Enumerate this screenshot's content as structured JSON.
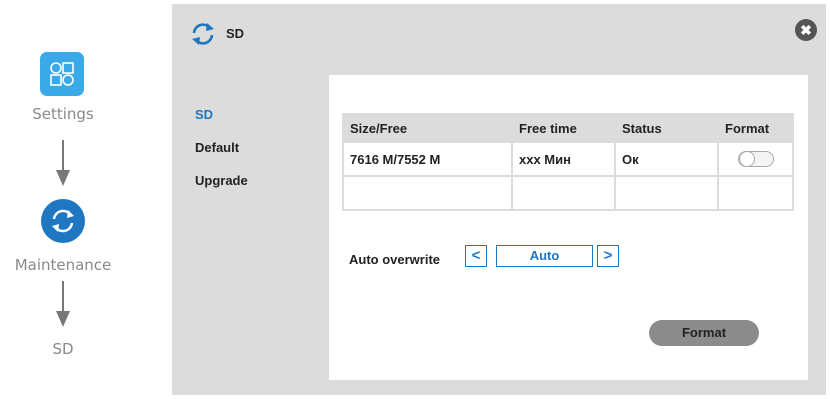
{
  "flow": {
    "settings_label": "Settings",
    "maintenance_label": "Maintenance",
    "sd_label": "SD"
  },
  "dialog": {
    "title": "SD",
    "close_glyph": "✖"
  },
  "nav": {
    "items": [
      {
        "label": "SD",
        "active": true
      },
      {
        "label": "Default",
        "active": false
      },
      {
        "label": "Upgrade",
        "active": false
      }
    ]
  },
  "table": {
    "headers": [
      "Size/Free",
      "Free time",
      "Status",
      "Format"
    ],
    "rows": [
      {
        "size_free": "7616 M/7552 M",
        "free_time": "xxx Мин",
        "status": "Ок",
        "format_toggle": "off"
      },
      {
        "size_free": "",
        "free_time": "",
        "status": "",
        "format_toggle": ""
      }
    ]
  },
  "auto_overwrite": {
    "label": "Auto overwrite",
    "prev_glyph": "<",
    "value": "Auto",
    "next_glyph": ">"
  },
  "format_button_label": "Format",
  "colors": {
    "accent": "#1f77c2",
    "tile": "#3aa9e8",
    "panel_bg": "#dcdcdc",
    "button_gray": "#8c8c8c"
  },
  "icons": [
    "settings-grid-icon",
    "refresh-icon",
    "arrow-down-icon",
    "close-icon",
    "chevron-left-icon",
    "chevron-right-icon"
  ]
}
